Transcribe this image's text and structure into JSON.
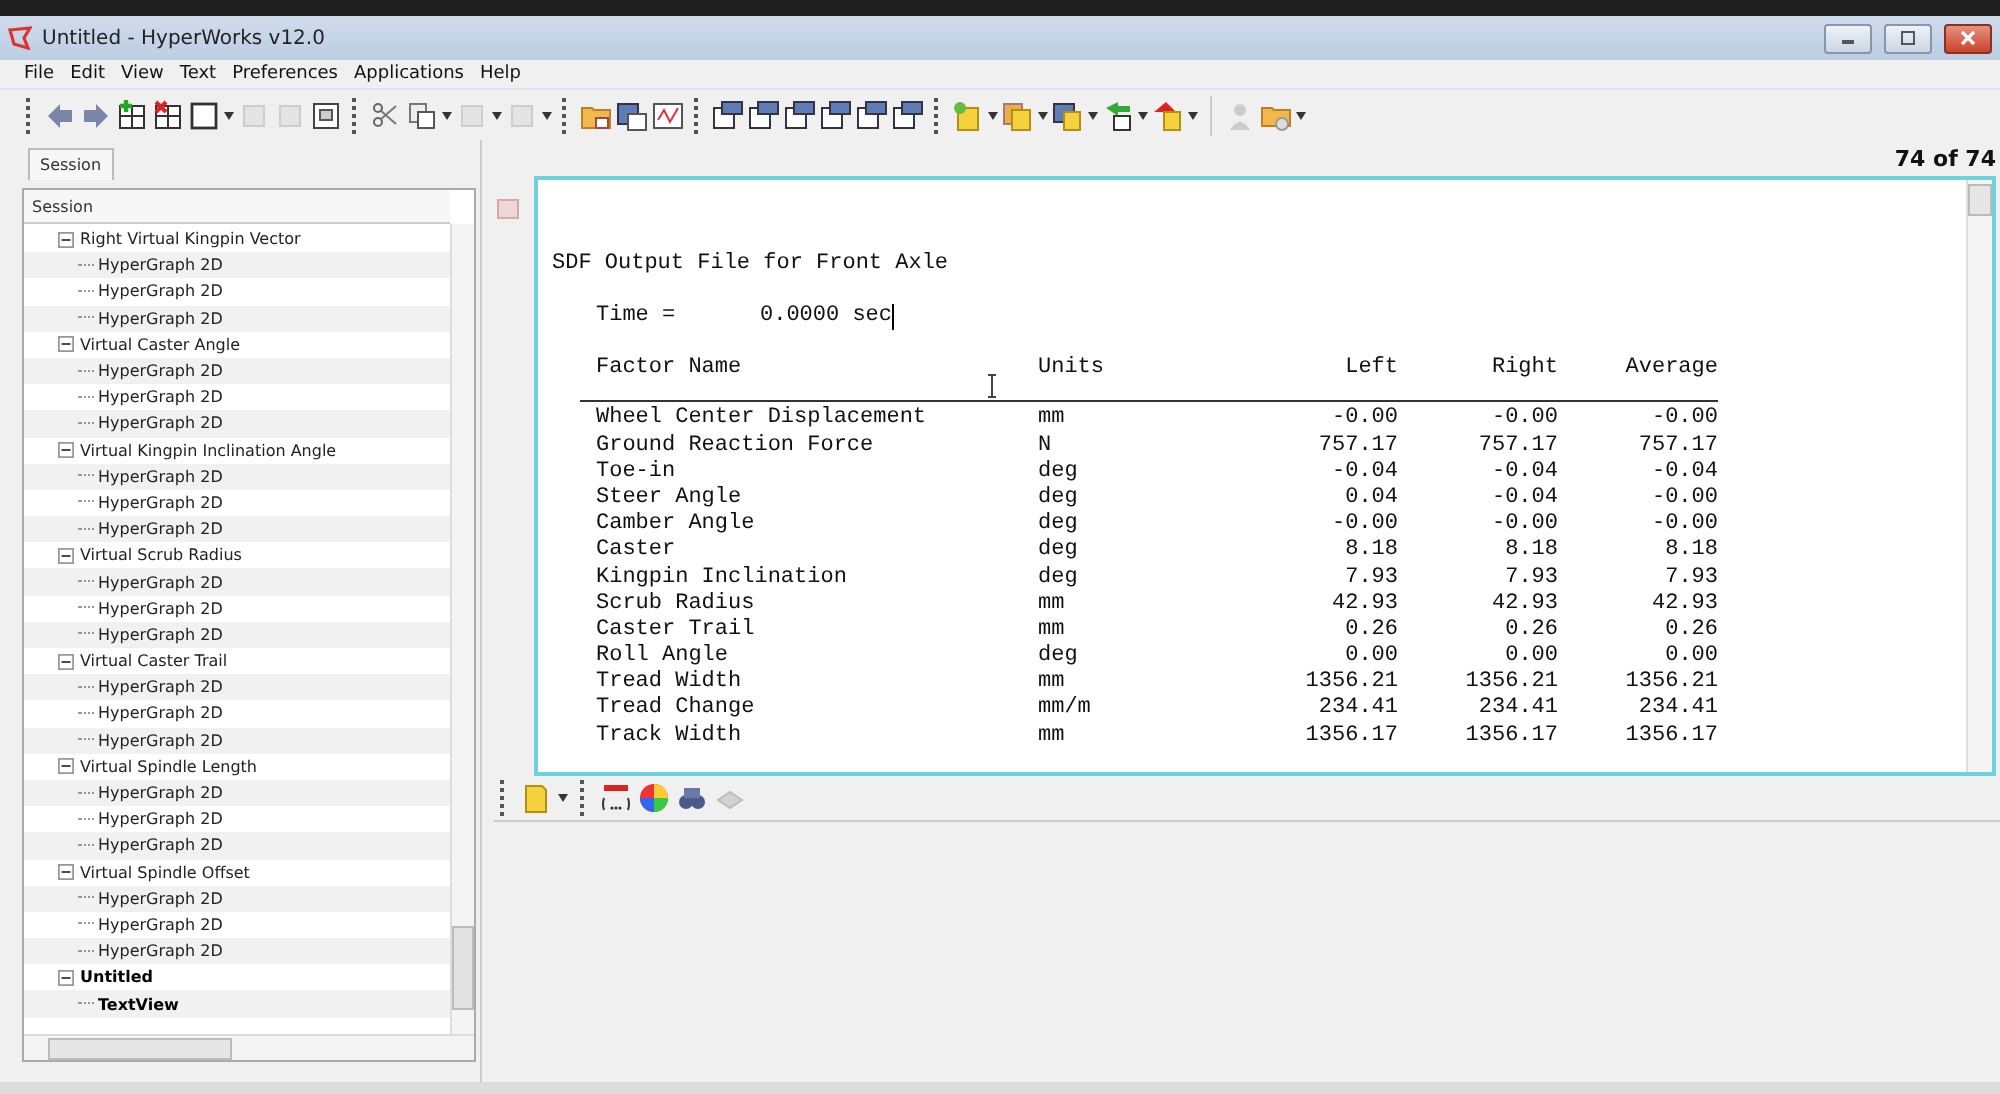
{
  "window": {
    "title": "Untitled - HyperWorks v12.0"
  },
  "menu": [
    "File",
    "Edit",
    "View",
    "Text",
    "Preferences",
    "Applications",
    "Help"
  ],
  "session_tab": {
    "label": "Session",
    "selected": true
  },
  "session_tree": {
    "header": "Session",
    "items": [
      {
        "label": "Right Virtual Kingpin Vector",
        "expanded": true,
        "active": false,
        "children": [
          {
            "label": "HyperGraph 2D",
            "active": false
          },
          {
            "label": "HyperGraph 2D",
            "active": false
          },
          {
            "label": "HyperGraph 2D",
            "active": false
          }
        ]
      },
      {
        "label": "Virtual Caster Angle",
        "expanded": true,
        "active": false,
        "children": [
          {
            "label": "HyperGraph 2D",
            "active": false
          },
          {
            "label": "HyperGraph 2D",
            "active": false
          },
          {
            "label": "HyperGraph 2D",
            "active": false
          }
        ]
      },
      {
        "label": "Virtual Kingpin Inclination Angle",
        "expanded": true,
        "active": false,
        "children": [
          {
            "label": "HyperGraph 2D",
            "active": false
          },
          {
            "label": "HyperGraph 2D",
            "active": false
          },
          {
            "label": "HyperGraph 2D",
            "active": false
          }
        ]
      },
      {
        "label": "Virtual Scrub Radius",
        "expanded": true,
        "active": false,
        "children": [
          {
            "label": "HyperGraph 2D",
            "active": false
          },
          {
            "label": "HyperGraph 2D",
            "active": false
          },
          {
            "label": "HyperGraph 2D",
            "active": false
          }
        ]
      },
      {
        "label": "Virtual Caster Trail",
        "expanded": true,
        "active": false,
        "children": [
          {
            "label": "HyperGraph 2D",
            "active": false
          },
          {
            "label": "HyperGraph 2D",
            "active": false
          },
          {
            "label": "HyperGraph 2D",
            "active": false
          }
        ]
      },
      {
        "label": "Virtual Spindle Length",
        "expanded": true,
        "active": false,
        "children": [
          {
            "label": "HyperGraph 2D",
            "active": false
          },
          {
            "label": "HyperGraph 2D",
            "active": false
          },
          {
            "label": "HyperGraph 2D",
            "active": false
          }
        ]
      },
      {
        "label": "Virtual Spindle Offset",
        "expanded": true,
        "active": false,
        "children": [
          {
            "label": "HyperGraph 2D",
            "active": false
          },
          {
            "label": "HyperGraph 2D",
            "active": false
          },
          {
            "label": "HyperGraph 2D",
            "active": false
          }
        ]
      },
      {
        "label": "Untitled",
        "expanded": true,
        "active": true,
        "children": [
          {
            "label": "TextView",
            "active": true
          }
        ]
      }
    ]
  },
  "page_counter": "74 of 74",
  "text_view": {
    "title": "SDF Output File for Front Axle",
    "time_label": "Time =",
    "time_value": "0.0000 sec",
    "columns": [
      "Factor Name",
      "Units",
      "Left",
      "Right",
      "Average"
    ],
    "rows": [
      [
        "Wheel Center Displacement",
        "mm",
        "-0.00",
        "-0.00",
        "-0.00"
      ],
      [
        "Ground Reaction Force",
        "N",
        "757.17",
        "757.17",
        "757.17"
      ],
      [
        "Toe-in",
        "deg",
        "-0.04",
        "-0.04",
        "-0.04"
      ],
      [
        "Steer Angle",
        "deg",
        "0.04",
        "-0.04",
        "-0.00"
      ],
      [
        "Camber Angle",
        "deg",
        "-0.00",
        "-0.00",
        "-0.00"
      ],
      [
        "Caster",
        "deg",
        "8.18",
        "8.18",
        "8.18"
      ],
      [
        "Kingpin Inclination",
        "deg",
        "7.93",
        "7.93",
        "7.93"
      ],
      [
        "Scrub Radius",
        "mm",
        "42.93",
        "42.93",
        "42.93"
      ],
      [
        "Caster Trail",
        "mm",
        "0.26",
        "0.26",
        "0.26"
      ],
      [
        "Roll Angle",
        "deg",
        "0.00",
        "0.00",
        "0.00"
      ],
      [
        "Tread Width",
        "mm",
        "1356.21",
        "1356.21",
        "1356.21"
      ],
      [
        "Tread Change",
        "mm/m",
        "234.41",
        "234.41",
        "234.41"
      ],
      [
        "Track Width",
        "mm",
        "1356.17",
        "1356.17",
        "1356.17"
      ]
    ]
  }
}
